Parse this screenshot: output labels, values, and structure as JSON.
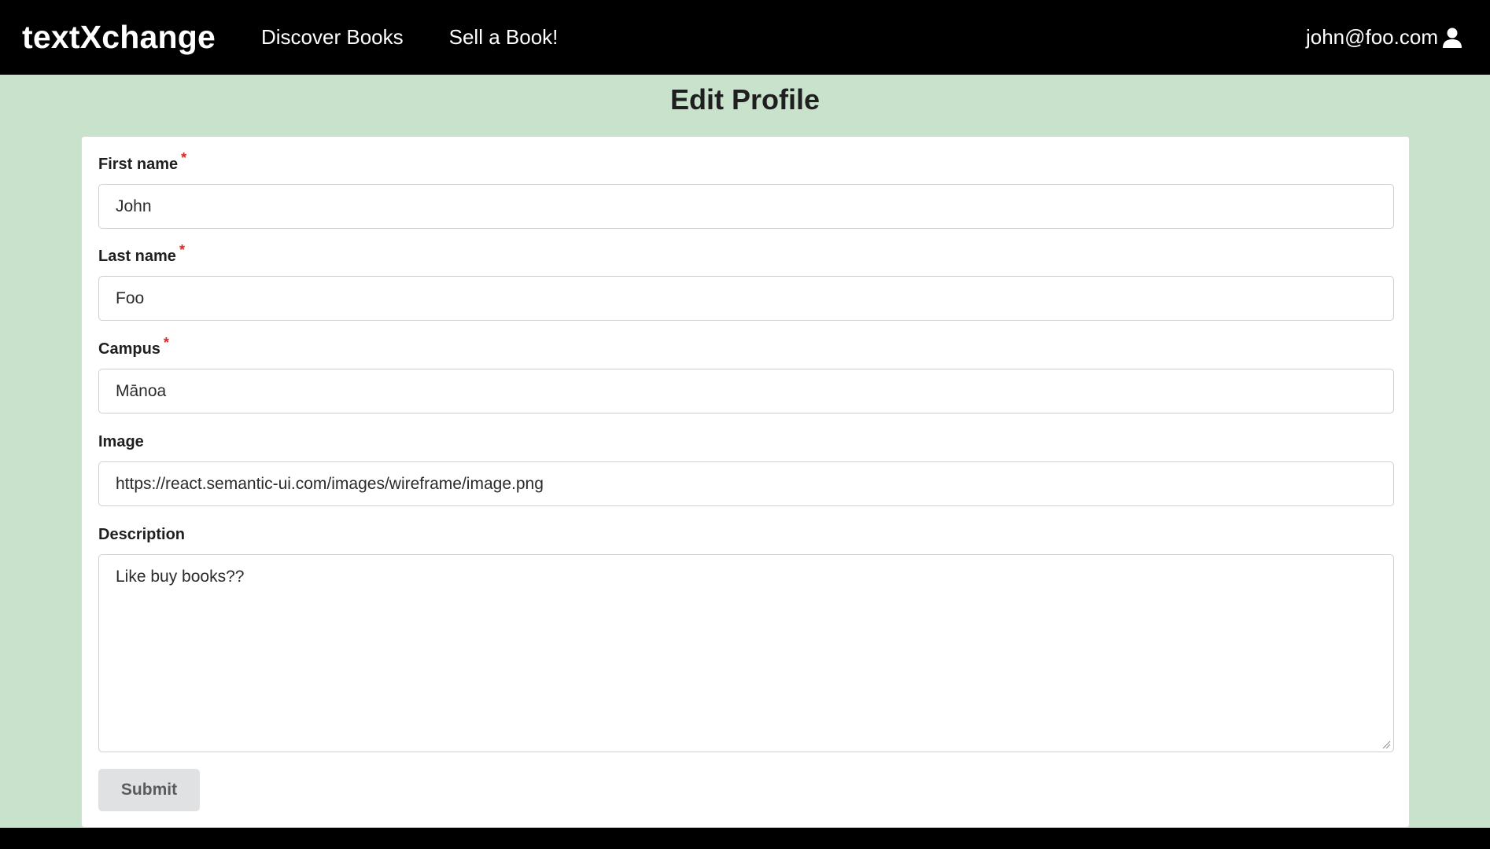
{
  "navbar": {
    "brand": "textXchange",
    "links": [
      "Discover Books",
      "Sell a Book!"
    ],
    "user_email": "john@foo.com",
    "user_icon": "user-icon"
  },
  "page": {
    "title": "Edit Profile"
  },
  "form": {
    "first_name": {
      "label": "First name",
      "required": "*",
      "value": "John"
    },
    "last_name": {
      "label": "Last name",
      "required": "*",
      "value": "Foo"
    },
    "campus": {
      "label": "Campus",
      "required": "*",
      "value": "Mānoa"
    },
    "image": {
      "label": "Image",
      "value": "https://react.semantic-ui.com/images/wireframe/image.png"
    },
    "description": {
      "label": "Description",
      "value": "Like buy books??"
    },
    "submit_label": "Submit"
  },
  "colors": {
    "background": "#c8e2cc",
    "navbar": "#000000",
    "required": "#db2828",
    "submit_bg": "#e0e1e2"
  }
}
